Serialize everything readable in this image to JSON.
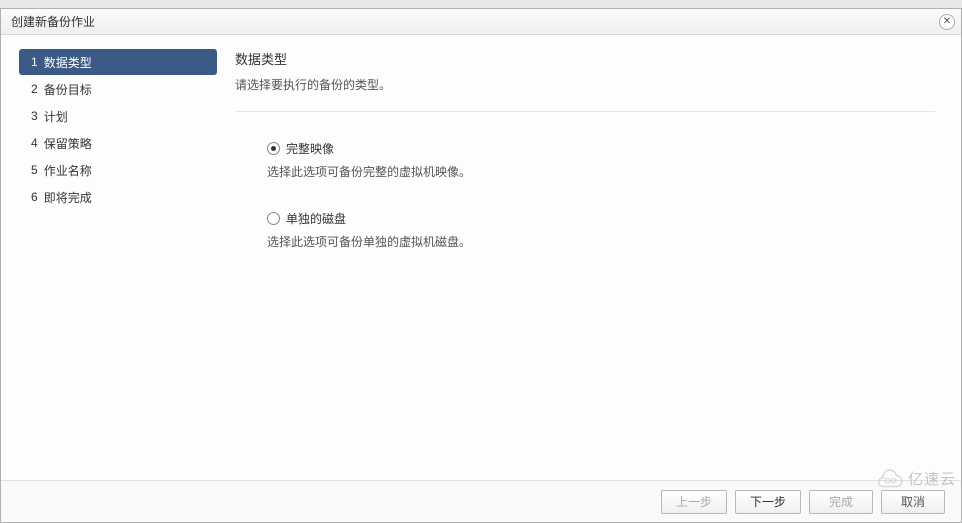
{
  "dialog": {
    "title": "创建新备份作业"
  },
  "sidebar": {
    "steps": [
      {
        "num": "1",
        "label": "数据类型",
        "active": true
      },
      {
        "num": "2",
        "label": "备份目标",
        "active": false
      },
      {
        "num": "3",
        "label": "计划",
        "active": false
      },
      {
        "num": "4",
        "label": "保留策略",
        "active": false
      },
      {
        "num": "5",
        "label": "作业名称",
        "active": false
      },
      {
        "num": "6",
        "label": "即将完成",
        "active": false
      }
    ]
  },
  "content": {
    "title": "数据类型",
    "subtitle": "请选择要执行的备份的类型。",
    "options": [
      {
        "label": "完整映像",
        "desc": "选择此选项可备份完整的虚拟机映像。",
        "checked": true
      },
      {
        "label": "单独的磁盘",
        "desc": "选择此选项可备份单独的虚拟机磁盘。",
        "checked": false
      }
    ]
  },
  "footer": {
    "prev": "上一步",
    "next": "下一步",
    "finish": "完成",
    "cancel": "取消"
  },
  "watermark": {
    "text": "亿速云"
  }
}
